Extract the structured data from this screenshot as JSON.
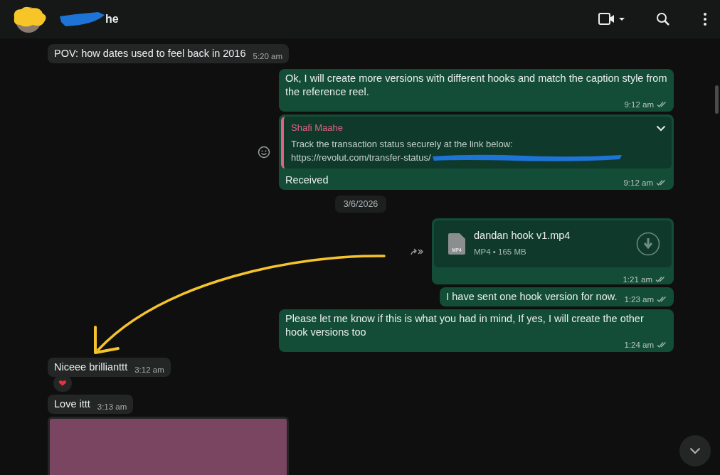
{
  "header": {
    "contact_name": "he"
  },
  "messages": [
    {
      "kind": "text",
      "outgoing": false,
      "text": "POV: how dates used to feel back in 2016",
      "time": "5:20 am"
    },
    {
      "kind": "text",
      "outgoing": true,
      "text": "Ok, I will create more versions with different hooks and match the caption style from the reference reel.",
      "time": "9:12 am",
      "read": false
    },
    {
      "kind": "quoted",
      "outgoing": true,
      "quote_author": "Shafi Maahe",
      "quote_lines": [
        "Track the transaction status securely at the link below:",
        "https://revolut.com/transfer-status/"
      ],
      "text": "Received",
      "time": "9:12 am",
      "read": false
    },
    {
      "kind": "date",
      "text": "3/6/2026"
    },
    {
      "kind": "file",
      "outgoing": true,
      "file_type": "MP4",
      "file_name": "dandan hook v1.mp4",
      "file_meta": "MP4 • 165 MB",
      "time": "1:21 am",
      "read": false
    },
    {
      "kind": "text",
      "outgoing": true,
      "text": "I have sent one hook version for now.",
      "time": "1:23 am",
      "read": false
    },
    {
      "kind": "text",
      "outgoing": true,
      "text": "Please let me know if this is what you had in mind, If yes, I will create the other hook versions too",
      "time": "1:24 am",
      "read": false
    },
    {
      "kind": "text",
      "outgoing": false,
      "text": "Niceee brillianttt",
      "time": "3:12 am",
      "reaction": "❤"
    },
    {
      "kind": "text",
      "outgoing": false,
      "text": "Love ittt",
      "time": "3:13 am"
    },
    {
      "kind": "media",
      "outgoing": false
    }
  ]
}
